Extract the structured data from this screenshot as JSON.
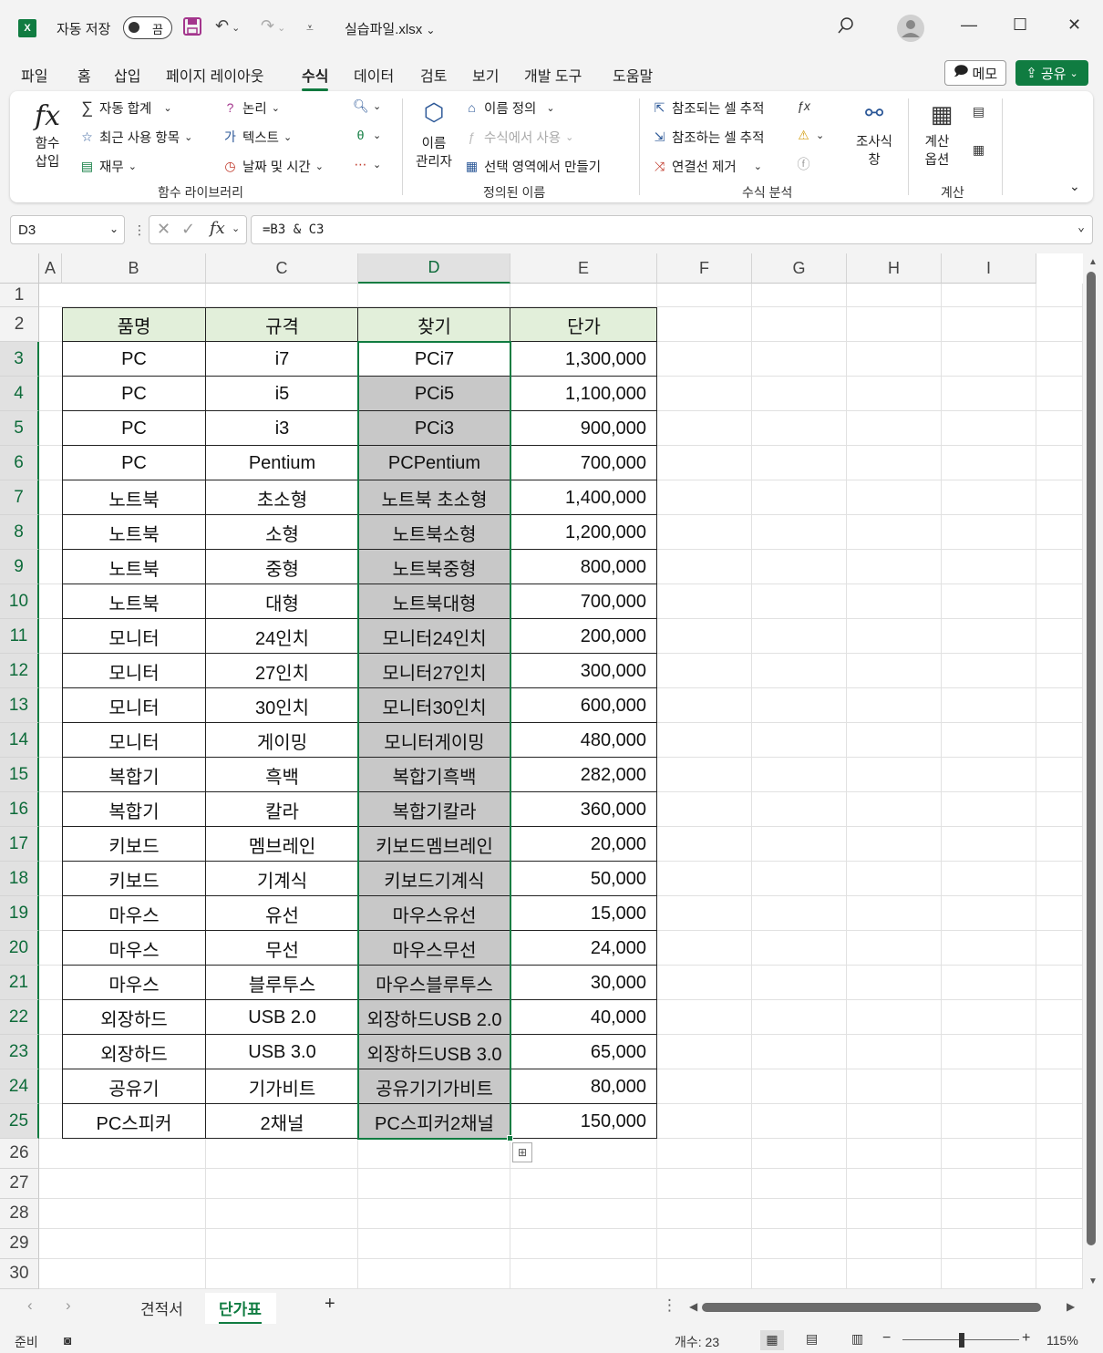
{
  "titlebar": {
    "app_logo": "X",
    "autosave_label": "자동 저장",
    "autosave_state": "끔",
    "filename": "실습파일.xlsx",
    "icons": [
      "save-icon",
      "undo-icon",
      "redo-icon",
      "customize-icon",
      "search-icon",
      "account-icon"
    ]
  },
  "menu": {
    "tabs": [
      "파일",
      "홈",
      "삽입",
      "페이지 레이아웃",
      "수식",
      "데이터",
      "검토",
      "보기",
      "개발 도구",
      "도움말"
    ],
    "active": "수식",
    "memo": "메모",
    "share": "공유"
  },
  "ribbon": {
    "insert_function": "함수\n삽입",
    "autosum": "자동 합계",
    "recent": "최근 사용 항목",
    "financial": "재무",
    "logical": "논리",
    "text": "텍스트",
    "datetime": "날짜 및 시간",
    "group_library": "함수 라이브러리",
    "name_manager": "이름\n관리자",
    "define_name": "이름 정의",
    "use_in_formula": "수식에서 사용",
    "create_from_selection": "선택 영역에서 만들기",
    "group_names": "정의된 이름",
    "trace_precedents": "참조되는 셀 추적",
    "trace_dependents": "참조하는 셀 추적",
    "remove_arrows": "연결선 제거",
    "watch_window": "조사식\n창",
    "group_auditing": "수식 분석",
    "calc_options": "계산\n옵션",
    "group_calc": "계산"
  },
  "formula_bar": {
    "name_box": "D3",
    "fx": "fx",
    "formula": "=B3 & C3"
  },
  "grid": {
    "columns": [
      "A",
      "B",
      "C",
      "D",
      "E",
      "F",
      "G",
      "H",
      "I"
    ],
    "selected_column": "D",
    "row_numbers": [
      "1",
      "2",
      "3",
      "4",
      "5",
      "6",
      "7",
      "8",
      "9",
      "10",
      "11",
      "12",
      "13",
      "14",
      "15",
      "16",
      "17",
      "18",
      "19",
      "20",
      "21",
      "22",
      "23",
      "24",
      "25",
      "26",
      "27",
      "28",
      "29",
      "30"
    ],
    "header": [
      "품명",
      "규격",
      "찾기",
      "단가"
    ],
    "rows": [
      [
        "PC",
        "i7",
        "PCi7",
        "1,300,000"
      ],
      [
        "PC",
        "i5",
        "PCi5",
        "1,100,000"
      ],
      [
        "PC",
        "i3",
        "PCi3",
        "900,000"
      ],
      [
        "PC",
        "Pentium",
        "PCPentium",
        "700,000"
      ],
      [
        "노트북",
        "초소형",
        "노트북 초소형",
        "1,400,000"
      ],
      [
        "노트북",
        "소형",
        "노트북소형",
        "1,200,000"
      ],
      [
        "노트북",
        "중형",
        "노트북중형",
        "800,000"
      ],
      [
        "노트북",
        "대형",
        "노트북대형",
        "700,000"
      ],
      [
        "모니터",
        "24인치",
        "모니터24인치",
        "200,000"
      ],
      [
        "모니터",
        "27인치",
        "모니터27인치",
        "300,000"
      ],
      [
        "모니터",
        "30인치",
        "모니터30인치",
        "600,000"
      ],
      [
        "모니터",
        "게이밍",
        "모니터게이밍",
        "480,000"
      ],
      [
        "복합기",
        "흑백",
        "복합기흑백",
        "282,000"
      ],
      [
        "복합기",
        "칼라",
        "복합기칼라",
        "360,000"
      ],
      [
        "키보드",
        "멤브레인",
        "키보드멤브레인",
        "20,000"
      ],
      [
        "키보드",
        "기계식",
        "키보드기계식",
        "50,000"
      ],
      [
        "마우스",
        "유선",
        "마우스유선",
        "15,000"
      ],
      [
        "마우스",
        "무선",
        "마우스무선",
        "24,000"
      ],
      [
        "마우스",
        "블루투스",
        "마우스블루투스",
        "30,000"
      ],
      [
        "외장하드",
        "USB 2.0",
        "외장하드USB 2.0",
        "40,000"
      ],
      [
        "외장하드",
        "USB 3.0",
        "외장하드USB 3.0",
        "65,000"
      ],
      [
        "공유기",
        "기가비트",
        "공유기기가비트",
        "80,000"
      ],
      [
        "PC스피커",
        "2채널",
        "PC스피커2채널",
        "150,000"
      ]
    ]
  },
  "sheets": {
    "tabs": [
      "견적서",
      "단가표"
    ],
    "active": "단가표",
    "add": "+"
  },
  "status": {
    "ready": "준비",
    "count": "개수: 23",
    "zoom": "115%"
  },
  "colors": {
    "accent": "#107c41",
    "header_fill": "#e2efda",
    "selection_fill": "#c8c8c8"
  }
}
